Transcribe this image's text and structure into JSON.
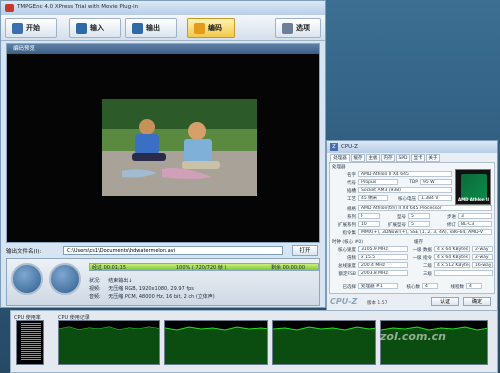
{
  "tmpgenc": {
    "title": "TMPGEnc 4.0 XPress Trial with Movie Plug-in",
    "toolbar": [
      {
        "label": "开始",
        "icon": "home-icon"
      },
      {
        "label": "输入",
        "icon": "input-icon"
      },
      {
        "label": "输出",
        "icon": "output-icon"
      },
      {
        "label": "编码",
        "icon": "encode-icon",
        "active": true
      },
      {
        "label": "选项",
        "icon": "wrench-icon"
      }
    ],
    "preview_header": "编码预览",
    "output_label": "输出文件名(I):",
    "output_path": "C:\\Users\\cs1\\Documents\\hdwatermelon.avi",
    "open_button": "打开",
    "progress": {
      "elapsed": "经过 00:01:15",
      "percent_text": "100% ( 720/720 帧 )",
      "remaining": "剩余 00:00:00",
      "fraction": 1.0
    },
    "status": {
      "state_label": "状况:",
      "state_value": "结束输出↓",
      "video_label": "视频:",
      "video_value": "无压缩 RGB, 1920x1080, 29.97 fps",
      "audio_label": "音频:",
      "audio_value": "无压缩 PCM, 48000 Hz, 16 bit, 2 ch (立体声)"
    }
  },
  "cpuz": {
    "title": "CPU-Z",
    "tabs": [
      "处理器",
      "缓存",
      "主板",
      "内存",
      "SPD",
      "显卡",
      "关于"
    ],
    "processor_group": "处理器",
    "fields": {
      "name_label": "名字",
      "name": "AMD Athlon II X4 645",
      "codename_label": "代号",
      "codename": "Propus",
      "tdp_label": "TDP",
      "tdp": "95 W",
      "package_label": "插槽",
      "package": "Socket AM3 (938)",
      "tech_label": "工艺",
      "tech": "45 纳米",
      "voltage_label": "核心电压",
      "voltage": "1.384 V",
      "spec_label": "规格",
      "spec": "AMD Athlon(tm) II X4 645 Processor",
      "family_label": "系列",
      "family": "F",
      "model_label": "型号",
      "model": "5",
      "stepping_label": "步进",
      "stepping": "3",
      "extfamily_label": "扩展系列",
      "extfamily": "10",
      "extmodel_label": "扩展型号",
      "extmodel": "5",
      "revision_label": "修订",
      "revision": "BL-C3",
      "instr_label": "指令集",
      "instr": "MMX(+), 3DNow!(+), SSE (1, 2, 3, 4A), x86-64, AMD-V"
    },
    "clocks_group": "时钟 (核心 #0)",
    "cache_group": "缓存",
    "clocks": {
      "core_speed_label": "核心速度",
      "core_speed": "3105.9 MHz",
      "multiplier_label": "倍频",
      "multiplier": "x 15.5",
      "bus_label": "总线速度",
      "bus": "200.4 MHz",
      "ht_label": "额定FSB",
      "ht": "2003.8 MHz"
    },
    "cache": {
      "l1d_label": "一级 数据",
      "l1d": "4 x 64 KBytes",
      "l1d_way": "2-way",
      "l1i_label": "一级 指令",
      "l1i": "4 x 64 KBytes",
      "l1i_way": "2-way",
      "l2_label": "二级",
      "l2": "4 x 512 KBytes",
      "l2_way": "16-way",
      "l3_label": "三级",
      "l3": ""
    },
    "selection_label": "已选择",
    "selection": "处理器 #1",
    "cores_label": "核心数",
    "cores": "4",
    "threads_label": "线程数",
    "threads": "4",
    "logo": "CPU-Z",
    "version": "版本 1.57",
    "ok_button": "确定",
    "validate_button": "认证",
    "amd_logo_text": "AMD Athlon II"
  },
  "taskmgr": {
    "cpu_usage_label": "CPU 使用率",
    "cpu_history_label": "CPU 使用记录"
  },
  "watermark": "zol.com.cn"
}
